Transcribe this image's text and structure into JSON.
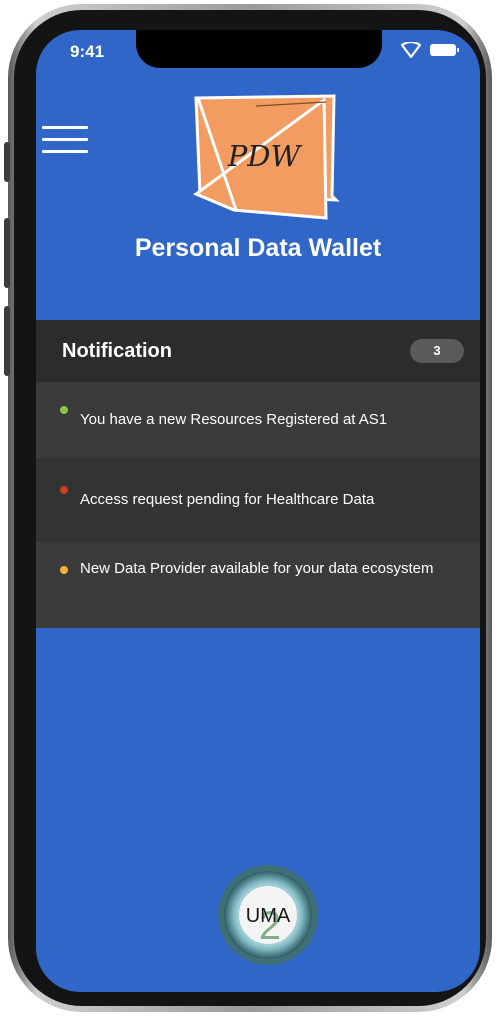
{
  "status_bar": {
    "time": "9:41"
  },
  "header": {
    "logo_text": "PDW",
    "title": "Personal Data Wallet"
  },
  "notifications": {
    "title": "Notification",
    "count": "3",
    "items": [
      {
        "text": "You have a new Resources Registered at AS1",
        "status_color": "#8bc34a"
      },
      {
        "text": "Access request pending for Healthcare Data",
        "status_color": "#d23b1f"
      },
      {
        "text": "New Data Provider available for your data ecosystem",
        "status_color": "#f2b33d"
      }
    ]
  },
  "footer": {
    "logo_text": "UMA",
    "logo_number": "2"
  },
  "colors": {
    "screen_bg": "#2f66c8",
    "panel_header_bg": "#2c2c2c",
    "panel_item_bg": "#3b3b3b",
    "logo_orange": "#f39c62"
  },
  "icons": [
    "hamburger-menu-icon",
    "wifi-icon",
    "battery-icon"
  ]
}
